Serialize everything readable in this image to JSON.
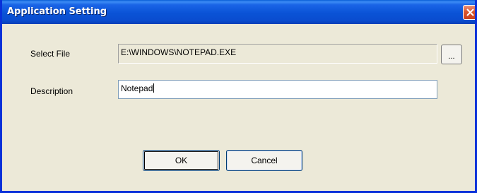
{
  "window": {
    "title": "Application Setting"
  },
  "form": {
    "select_file_label": "Select File",
    "select_file_value": "E:\\WINDOWS\\NOTEPAD.EXE",
    "browse_label": "...",
    "description_label": "Description",
    "description_value": "Notepad"
  },
  "buttons": {
    "ok_label": "OK",
    "cancel_label": "Cancel"
  },
  "colors": {
    "titlebar": "#0a53d6",
    "dialog_bg": "#ece9d8",
    "close_button": "#d8572f"
  },
  "icons": {
    "close": "close-icon"
  }
}
